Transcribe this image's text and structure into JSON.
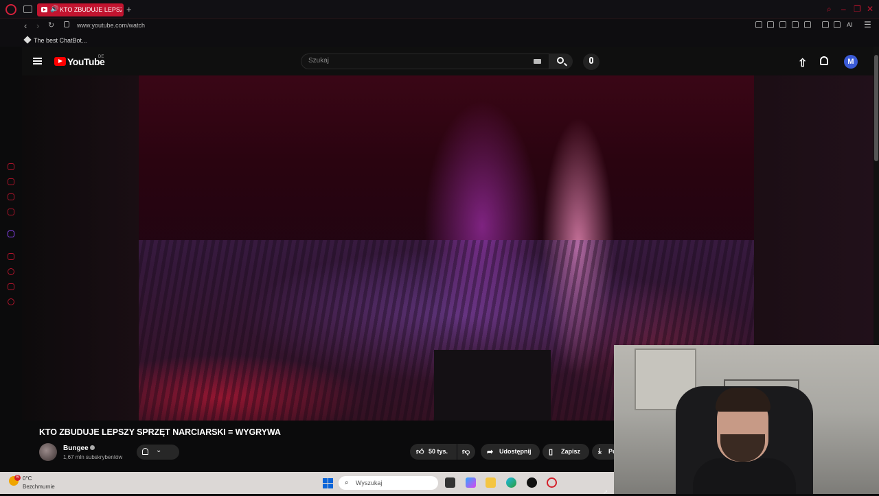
{
  "browser": {
    "tab_title": "KTO ZBUDUJE LEPSZY",
    "tab_sound_icon": "speaker-icon",
    "new_tab_icon": "plus-icon",
    "url": "www.youtube.com/watch",
    "bookmark": "The best ChatBot...",
    "ai_label": "AI",
    "accent_color": "#c2142f"
  },
  "youtube": {
    "logo_text": "YouTube",
    "country_code": "DE",
    "search_placeholder": "Szukaj",
    "avatar_letter": "M"
  },
  "video": {
    "title": "KTO ZBUDUJE LEPSZY SPRZĘT NARCIARSKI = WYGRYWA",
    "channel_name": "Bungee",
    "subscribers": "1,67 mln subskrybentów",
    "likes": "50 tys.",
    "share_label": "Udostępnij",
    "save_label": "Zapisz",
    "download_label": "Po"
  },
  "taskbar": {
    "weather_temp": "0°C",
    "weather_desc": "Bezchmurnie",
    "weather_badge": "6",
    "search_label": "Wyszukaj"
  }
}
